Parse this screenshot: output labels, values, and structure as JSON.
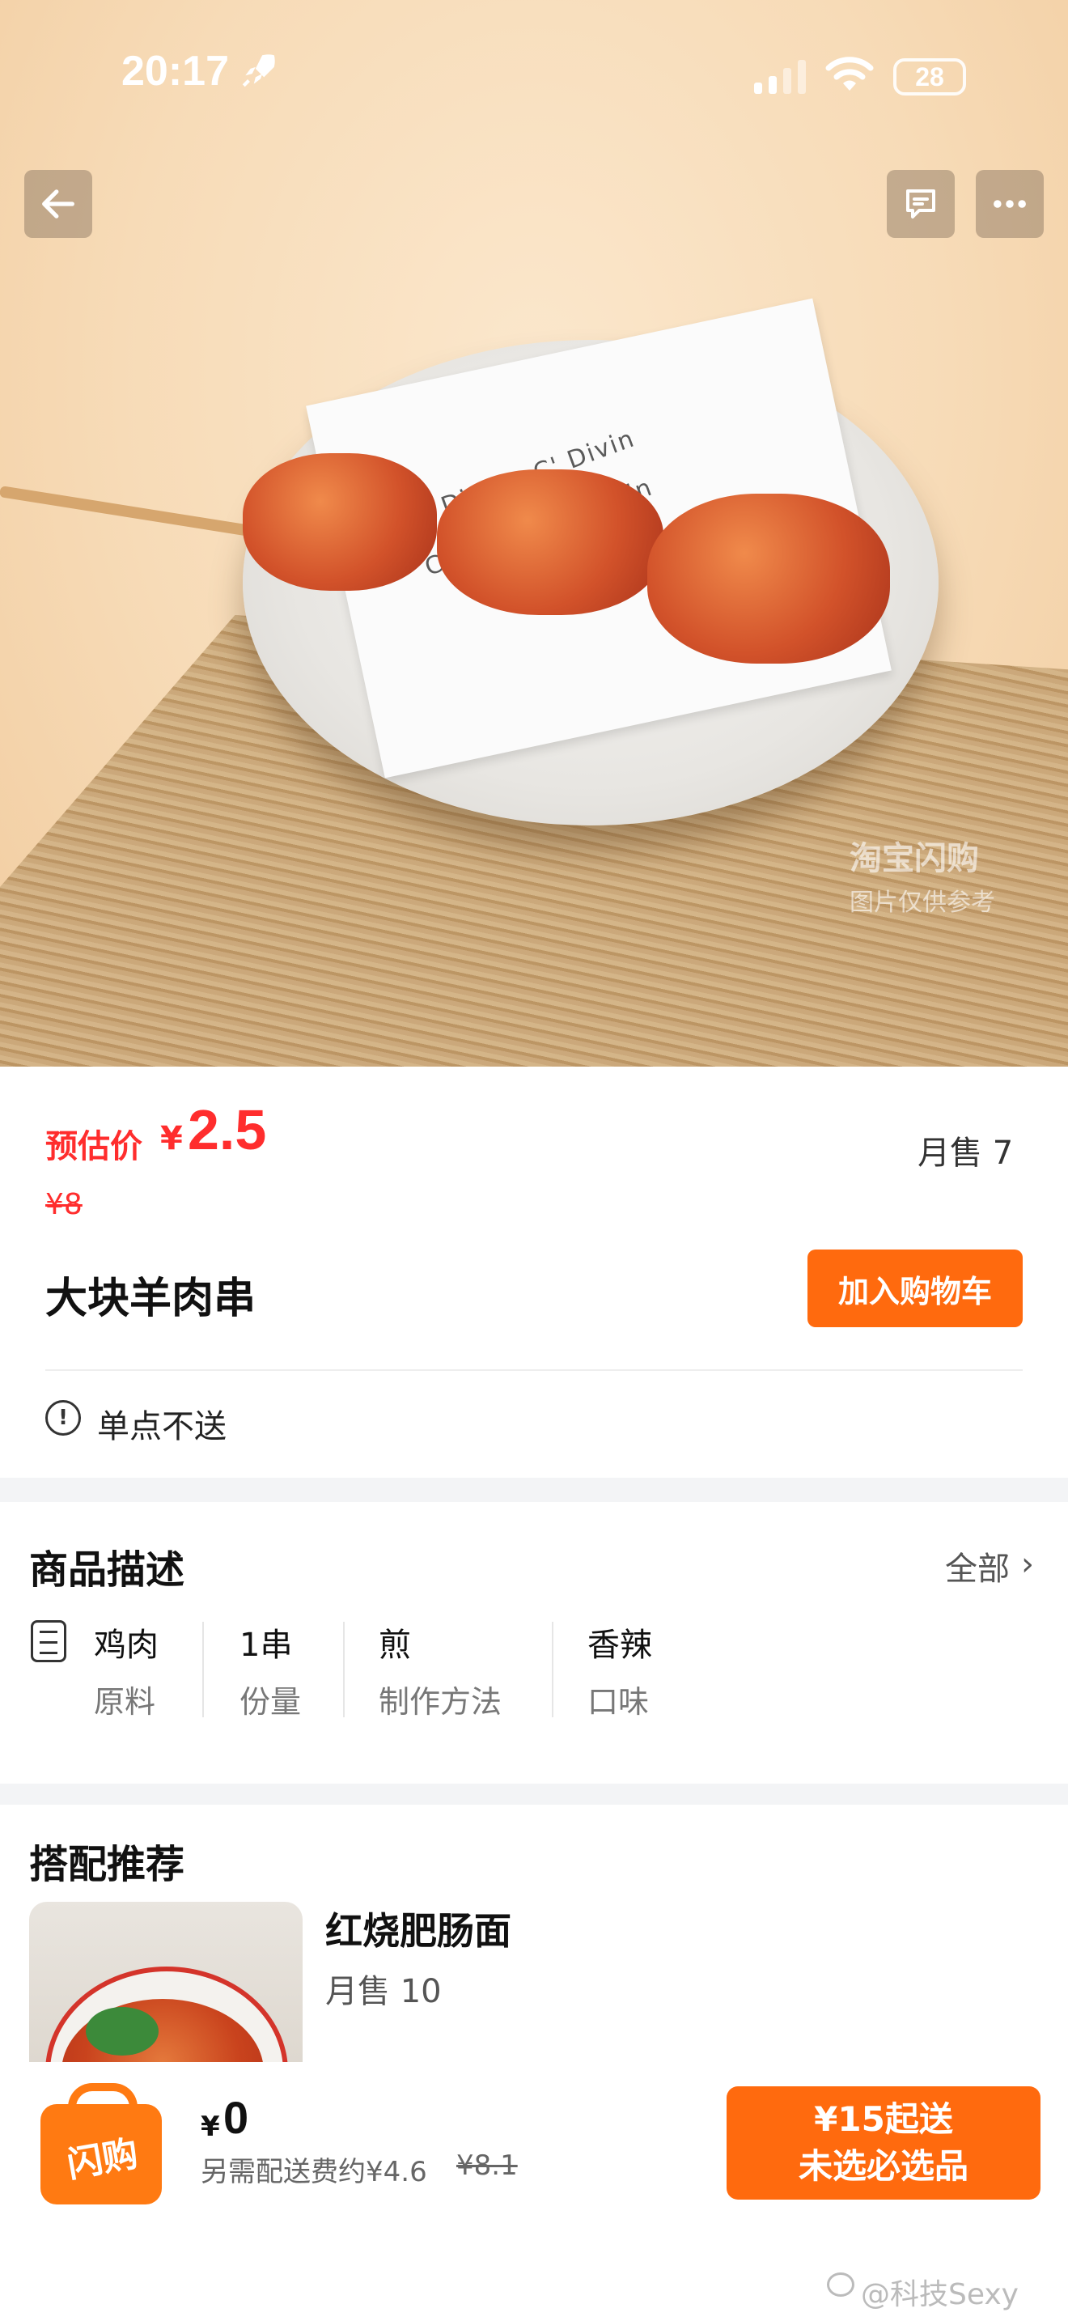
{
  "status_bar": {
    "time": "20:17",
    "battery": "28"
  },
  "hero": {
    "watermark_line1": "淘宝闪购",
    "watermark_line2": "图片仅供参考",
    "paper_print": "C' Divin"
  },
  "product": {
    "price_label": "预估价",
    "currency": "¥",
    "price": "2.5",
    "monthly_sales": "月售 7",
    "original_price": "¥8",
    "name": "大块羊肉串",
    "add_to_cart": "加入购物车",
    "notice": "单点不送"
  },
  "description": {
    "title": "商品描述",
    "all_label": "全部",
    "attributes": [
      {
        "value": "鸡肉",
        "key": "原料"
      },
      {
        "value": "1串",
        "key": "份量"
      },
      {
        "value": "煎",
        "key": "制作方法"
      },
      {
        "value": "香辣",
        "key": "口味"
      }
    ]
  },
  "recommend": {
    "title": "搭配推荐",
    "items": [
      {
        "name": "红烧肥肠面",
        "sales": "月售 10"
      }
    ]
  },
  "cart_bar": {
    "brand_badge": "闪购",
    "currency": "¥",
    "total": "0",
    "delivery_note": "另需配送费约¥4.6",
    "delivery_original": "¥8.1",
    "checkout_line1": "¥15起送",
    "checkout_line2": "未选必选品"
  },
  "credit": "@科技Sexy",
  "colors": {
    "accent": "#ff6a0e",
    "price": "#ff2d2d"
  }
}
